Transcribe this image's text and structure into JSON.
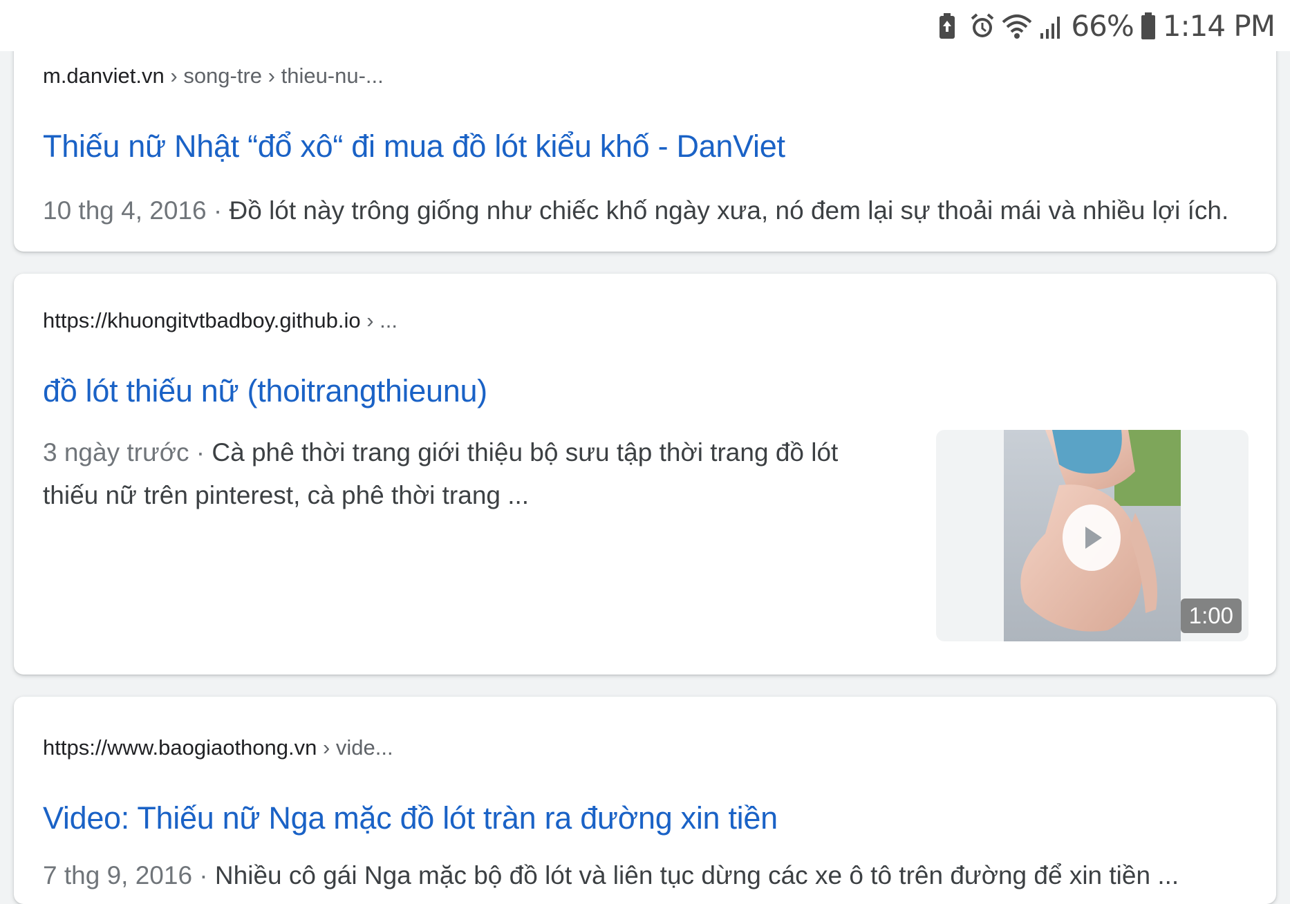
{
  "status_bar": {
    "battery_percent": "66%",
    "time": "1:14 PM",
    "icons": [
      "battery-saver-icon",
      "alarm-icon",
      "wifi-icon",
      "signal-icon",
      "battery-icon"
    ]
  },
  "results": [
    {
      "domain": "m.danviet.vn",
      "breadcrumb": " › song-tre › thieu-nu-...",
      "title": "Thiếu nữ Nhật “đổ xô“ đi mua đồ lót kiểu khố - DanViet",
      "date": "10 thg 4, 2016",
      "separator": " · ",
      "snippet": "Đồ lót này trông giống như chiếc khố ngày xưa, nó đem lại sự thoải mái và nhiều lợi ích."
    },
    {
      "domain": "https://khuongitvtbadboy.github.io",
      "breadcrumb": " › ...",
      "title": "đồ lót thiếu nữ (thoitrangthieunu)",
      "date": "3 ngày trước",
      "separator": " · ",
      "snippet": "Cà phê thời trang giới thiệu bộ sưu tập thời trang đồ lót thiếu nữ trên pinterest, cà phê thời trang ...",
      "video": {
        "duration": "1:00",
        "icon": "play-icon"
      }
    },
    {
      "domain": "https://www.baogiaothong.vn",
      "breadcrumb": " › vide...",
      "title": "Video: Thiếu nữ Nga mặc đồ lót tràn ra đường xin tiền",
      "date": "7 thg 9, 2016",
      "separator": " · ",
      "snippet": "Nhiều cô gái Nga mặc bộ đồ lót và liên tục dừng các xe ô tô trên đường để xin tiền ..."
    }
  ],
  "colors": {
    "link": "#1a62c6",
    "text": "#202124",
    "muted": "#70757a",
    "page_bg": "#f1f3f4"
  }
}
